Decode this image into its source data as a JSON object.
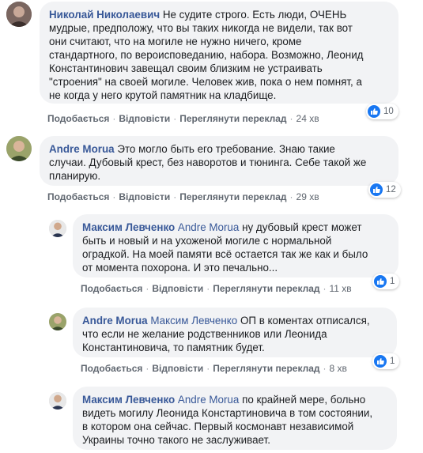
{
  "colors": {
    "author": "#385898",
    "bubble": "#f2f3f5",
    "like": "#1877f2",
    "meta": "#606770"
  },
  "action_labels": {
    "like": "Подобається",
    "reply": "Відповісти",
    "translate": "Переглянути переклад"
  },
  "comments": [
    {
      "author": "Николай Николаевич",
      "mention": "",
      "text_lines": [
        "Не судите строго. Есть люди, ОЧЕНЬ",
        "мудрые, предположу, что вы таких никогда не видели, так вот",
        "они считают, что на могиле не нужно ничего, кроме",
        "стандартного, по вероисповеданию, набора. Возможно, Леонид",
        "Константинович завещал своим близким не устраивать",
        "\"строения\" на своей могиле. Человек жив, пока о нем помнят, а",
        "не когда у него крутой памятник на кладбище."
      ],
      "time": "24 хв",
      "likes": "10",
      "avatar_icon": "user-avatar-icon"
    },
    {
      "author": "Andre Morua",
      "mention": "",
      "text_lines": [
        "Это могло быть его требование. Знаю такие",
        "случаи. Дубовый крест, без наворотов и тюнинга. Себе такой же",
        "планирую."
      ],
      "time": "29 хв",
      "likes": "12",
      "avatar_icon": "user-avatar-icon"
    },
    {
      "author": "Максим Левченко",
      "mention": "Andre Morua",
      "text_lines": [
        "ну дубовый крест может",
        "быть и новый и на ухоженой могиле с нормальной",
        "оградкой. На моей памяти всё остается так же как и было",
        "от момента похорона. И это печально..."
      ],
      "time": "11 хв",
      "likes": "1",
      "avatar_icon": "user-avatar-icon"
    },
    {
      "author": "Andre Morua",
      "mention": "Максим Левченко",
      "text_lines": [
        "ОП в коментах отписался,",
        "что если не желание родственников или Леонида",
        "Константиновича, то памятник будет."
      ],
      "time": "8 хв",
      "likes": "1",
      "avatar_icon": "user-avatar-icon"
    },
    {
      "author": "Максим Левченко",
      "mention": "Andre Morua",
      "text_lines": [
        "по крайней мере, больно",
        "видеть могилу Леонида Констартиновича в том состоянии,",
        "в котором она сейчас. Первый космонавт независимой",
        "Украины точно такого не заслуживает."
      ],
      "time": "",
      "likes": "",
      "avatar_icon": "user-avatar-icon"
    }
  ]
}
